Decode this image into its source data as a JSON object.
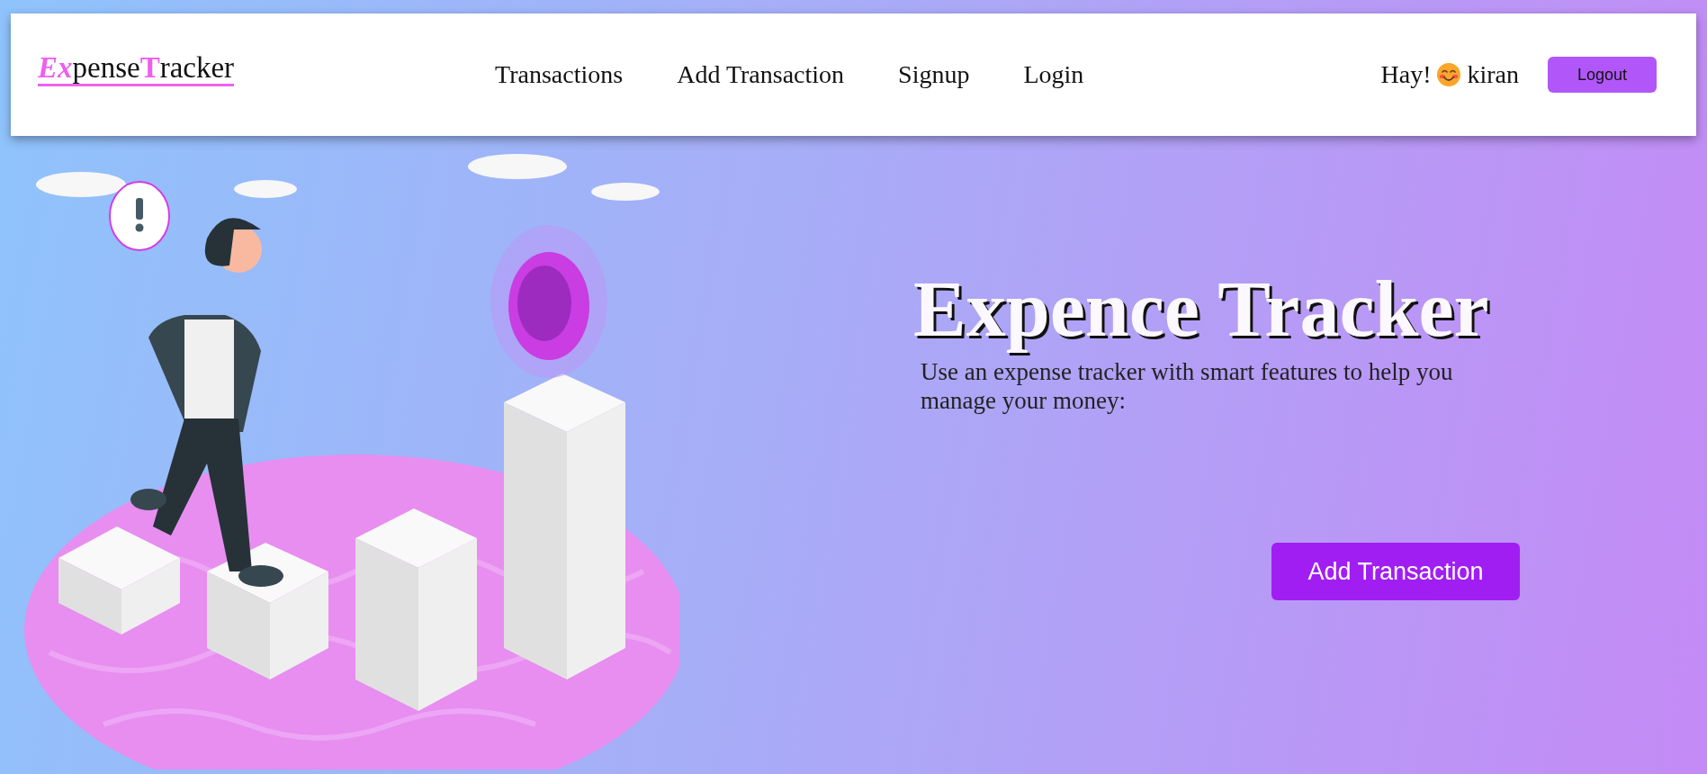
{
  "logo": [
    {
      "text": "Ex",
      "accent": true,
      "italic": true
    },
    {
      "text": "pense",
      "accent": false,
      "italic": false
    },
    {
      "text": "T",
      "accent": true,
      "italic": false
    },
    {
      "text": "racker",
      "accent": false,
      "italic": false
    }
  ],
  "nav": [
    "Transactions",
    "Add Transaction",
    "Signup",
    "Login"
  ],
  "user": {
    "greeting": "Hay!",
    "name": "kiran"
  },
  "logout_button": "Logout",
  "hero": {
    "title": "Expence Tracker",
    "subtitle": "Use an expense tracker with smart features to help you manage your money:",
    "button": "Add Transaction"
  }
}
